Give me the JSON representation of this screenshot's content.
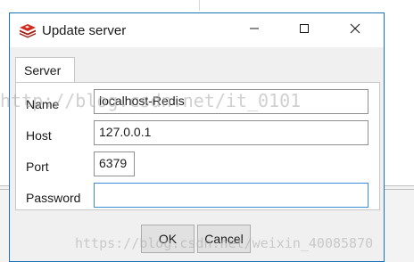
{
  "dialog": {
    "title": "Update server",
    "app_icon": "redis-logo-icon",
    "window_controls": {
      "minimize": "minimize-icon",
      "maximize": "maximize-icon",
      "close": "close-icon"
    }
  },
  "tabs": [
    {
      "label": "Server",
      "active": true
    }
  ],
  "form": {
    "name": {
      "label": "Name",
      "value": "localhost-Redis"
    },
    "host": {
      "label": "Host",
      "value": "127.0.0.1"
    },
    "port": {
      "label": "Port",
      "value": "6379"
    },
    "password": {
      "label": "Password",
      "value": ""
    }
  },
  "buttons": {
    "ok": "OK",
    "cancel": "Cancel"
  },
  "watermarks": {
    "top": "http://blog.csdn.net/it_0101",
    "bottom": "https://blog.csdn.net/weixin_40085870"
  },
  "colors": {
    "accent": "#1a73b5",
    "logo": "#d12a1f"
  }
}
